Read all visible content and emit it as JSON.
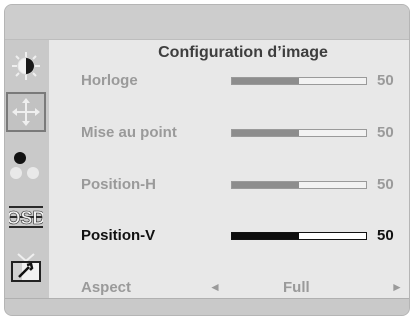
{
  "menu": {
    "title": "Configuration d’image"
  },
  "sidebar": {
    "items": [
      {
        "name": "brightness",
        "icon": "sun-icon",
        "selected": false
      },
      {
        "name": "image-setup",
        "icon": "move-arrows-icon",
        "selected": true
      },
      {
        "name": "color",
        "icon": "color-dots-icon",
        "selected": false
      },
      {
        "name": "osd",
        "icon": "osd-icon",
        "label": "OSD",
        "selected": false
      },
      {
        "name": "extra",
        "icon": "tv-wrench-icon",
        "selected": false
      }
    ]
  },
  "settings": {
    "horloge": {
      "label": "Horloge",
      "value": "50",
      "level": 0.5
    },
    "focus": {
      "label": "Mise au point",
      "value": "50",
      "level": 0.5
    },
    "position_h": {
      "label": "Position-H",
      "value": "50",
      "level": 0.5
    },
    "position_v": {
      "label": "Position-V",
      "value": "50",
      "level": 0.5,
      "active": true
    },
    "aspect": {
      "label": "Aspect",
      "option": "Full",
      "left_arrow": "◄",
      "right_arrow": "►"
    }
  },
  "colors": {
    "frame": "#c9c9c9",
    "panel": "#e8e8e8",
    "inactive_text": "#9a9a9a",
    "active_text": "#111111"
  }
}
